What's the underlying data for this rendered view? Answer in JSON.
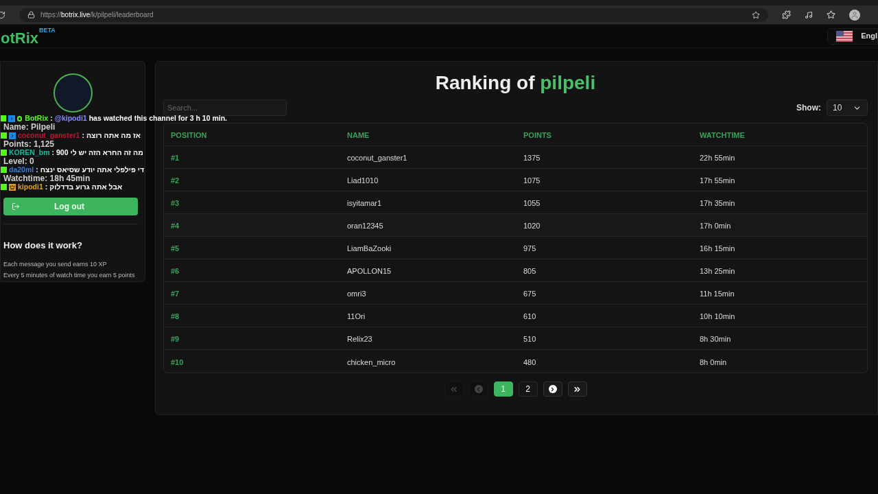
{
  "browser": {
    "url_host": "botrix.live",
    "url_prefix": "https://",
    "url_path": "/k/pilpeli/leaderboard"
  },
  "header": {
    "logo": "otRix",
    "badge": "BETA",
    "language": "Engl"
  },
  "profile": {
    "fields": [
      "Name: Pilpeli",
      "Points: 1,125",
      "Level: 0",
      "Watchtime: 18h 45min"
    ],
    "logout": "Log out",
    "help_title": "How does it work?",
    "help_lines": [
      "Each message you send earns 10 XP",
      "Every 5 minutes of watch time you earn 5 points"
    ]
  },
  "chat": [
    {
      "badges": [
        {
          "kind": "kick"
        },
        {
          "kind": "boost"
        },
        {
          "kind": "check"
        }
      ],
      "user": "BotRix",
      "separator": ":",
      "color": "#53fc18",
      "mention": "@kipodi1",
      "message": "has watched this channel for 3 h 10 min."
    },
    {
      "badges": [
        {
          "kind": "kick"
        },
        {
          "kind": "boost"
        }
      ],
      "user": "coconut_ganster1",
      "separator": ":",
      "color": "#c8102e",
      "message": "אז מה אתה רוצה"
    },
    {
      "badges": [
        {
          "kind": "kick"
        }
      ],
      "user": "KOREN_bm",
      "separator": ":",
      "color": "#1abc9c",
      "message": "מה זה החרא הזה יש לי 900"
    },
    {
      "badges": [
        {
          "kind": "kick"
        }
      ],
      "user": "da20ml",
      "separator": ":",
      "color": "#3a7bd5",
      "message": "די פילפלי אתה יודע שסיאס ינצח"
    },
    {
      "badges": [
        {
          "kind": "kick"
        },
        {
          "kind": "crown"
        }
      ],
      "user": "kipodi1",
      "separator": ":",
      "color": "#e0a030",
      "message": "אבל אתה גרוע בדדלוק"
    }
  ],
  "ranking": {
    "title": "Ranking of ",
    "channel": "pilpeli",
    "search": {
      "placeholder": "Search..."
    },
    "show_label": "Show:",
    "show_value": "10",
    "columns": [
      "POSITION",
      "NAME",
      "POINTS",
      "WATCHTIME"
    ],
    "rows": [
      [
        "#1",
        "coconut_ganster1",
        "1375",
        "22h 55min"
      ],
      [
        "#2",
        "Liad1010",
        "1075",
        "17h 55min"
      ],
      [
        "#3",
        "isyitamar1",
        "1055",
        "17h 35min"
      ],
      [
        "#4",
        "oran12345",
        "1020",
        "17h 0min"
      ],
      [
        "#5",
        "LiamBaZooki",
        "975",
        "16h 15min"
      ],
      [
        "#6",
        "APOLLON15",
        "805",
        "13h 25min"
      ],
      [
        "#7",
        "omri3",
        "675",
        "11h 15min"
      ],
      [
        "#8",
        "11Ori",
        "610",
        "10h 10min"
      ],
      [
        "#9",
        "Relix23",
        "510",
        "8h 30min"
      ],
      [
        "#10",
        "chicken_micro",
        "480",
        "8h 0min"
      ]
    ],
    "pagination": [
      {
        "kind": "first",
        "disabled": true
      },
      {
        "kind": "prev",
        "disabled": true
      },
      {
        "kind": "page",
        "label": "1",
        "selected": true
      },
      {
        "kind": "page",
        "label": "2",
        "selected": false
      },
      {
        "kind": "next",
        "disabled": false
      },
      {
        "kind": "last",
        "disabled": false
      }
    ]
  }
}
